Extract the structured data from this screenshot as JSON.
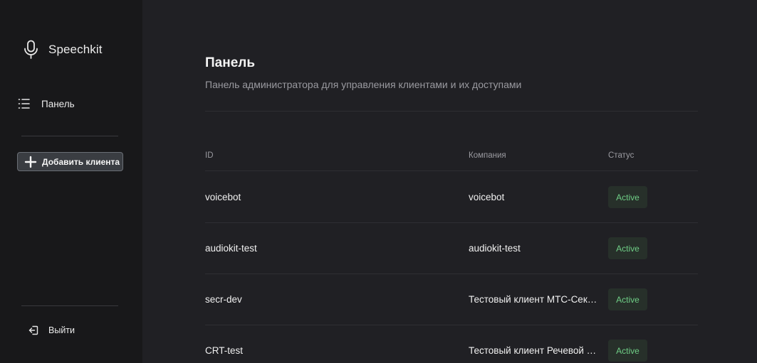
{
  "sidebar": {
    "brand": {
      "name": "Speechkit",
      "icon": "microphone-icon"
    },
    "nav": [
      {
        "label": "Панель",
        "icon": "list-icon"
      }
    ],
    "add_client": {
      "label": "Добавить клиента",
      "icon": "plus-icon"
    },
    "logout": {
      "label": "Выйти",
      "icon": "logout-icon"
    }
  },
  "main": {
    "title": "Панель",
    "subtitle": "Панель администратора для управления клиентами и их доступами",
    "table": {
      "columns": [
        "ID",
        "Компания",
        "Статус"
      ],
      "rows": [
        {
          "id": "voicebot",
          "company": "voicebot",
          "status": "Active"
        },
        {
          "id": "audiokit-test",
          "company": "audiokit-test",
          "status": "Active"
        },
        {
          "id": "secr-dev",
          "company": "Тестовый клиент МТС-Секр...",
          "status": "Active"
        },
        {
          "id": "CRT-test",
          "company": "Тестовый клиент Речевой а...",
          "status": "Active"
        }
      ]
    }
  },
  "colors": {
    "sidebar_bg": "#18181a",
    "main_bg": "#202024",
    "badge_bg": "#27302a",
    "badge_text": "#6fce86"
  }
}
